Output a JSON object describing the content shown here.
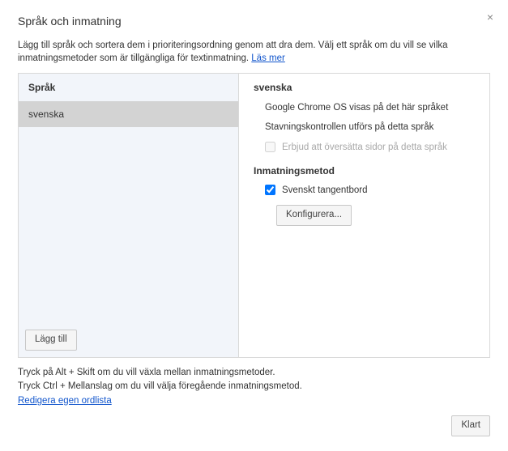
{
  "dialog": {
    "title": "Språk och inmatning",
    "intro": "Lägg till språk och sortera dem i prioriteringsordning genom att dra dem. Välj ett språk om du vill se vilka inmatningsmetoder som är tillgängliga för textinmatning. ",
    "learn_more": "Läs mer"
  },
  "left": {
    "header": "Språk",
    "items": [
      {
        "label": "svenska",
        "selected": true
      }
    ],
    "add_button": "Lägg till"
  },
  "right": {
    "language_title": "svenska",
    "display_line": "Google Chrome OS visas på det här språket",
    "spellcheck_line": "Stavningskontrollen utförs på detta språk",
    "translate_offer": {
      "label": "Erbjud att översätta sidor på detta språk",
      "checked": false,
      "disabled": true
    },
    "input_method_header": "Inmatningsmetod",
    "input_methods": [
      {
        "label": "Svenskt tangentbord",
        "checked": true
      }
    ],
    "configure_button": "Konfigurera..."
  },
  "tips": {
    "line1": "Tryck på Alt + Skift om du vill växla mellan inmatningsmetoder.",
    "line2": "Tryck Ctrl + Mellanslag om du vill välja föregående inmatningsmetod.",
    "edit_dict": "Redigera egen ordlista"
  },
  "footer": {
    "done": "Klart"
  }
}
